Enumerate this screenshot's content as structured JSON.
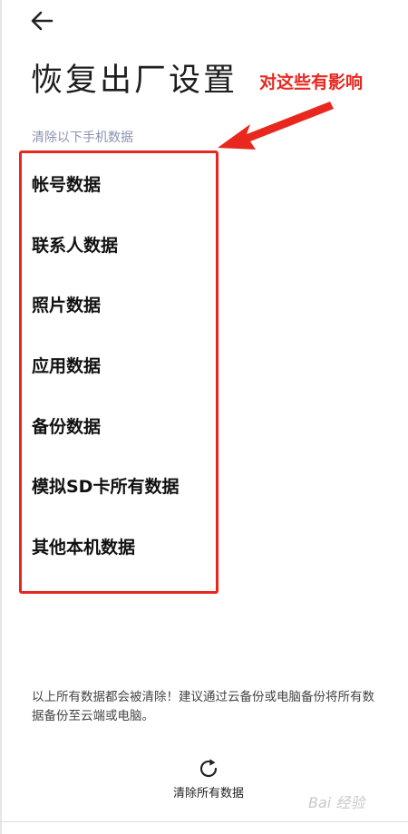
{
  "header": {
    "title": "恢复出厂设置",
    "back_icon": "arrow-left-icon"
  },
  "annotation": {
    "text": "对这些有影响",
    "color": "#e8281f"
  },
  "section": {
    "label": "清除以下手机数据"
  },
  "data_items": [
    {
      "label": "帐号数据"
    },
    {
      "label": "联系人数据"
    },
    {
      "label": "照片数据"
    },
    {
      "label": "应用数据"
    },
    {
      "label": "备份数据"
    },
    {
      "label": "模拟SD卡所有数据"
    },
    {
      "label": "其他本机数据"
    }
  ],
  "footer": {
    "note": "以上所有数据都会被清除！建议通过云备份或电脑备份将所有数据备份至云端或电脑。",
    "clear_button_label": "清除所有数据",
    "clear_button_icon": "refresh-icon"
  },
  "watermark": {
    "text": "Bai 经验"
  }
}
